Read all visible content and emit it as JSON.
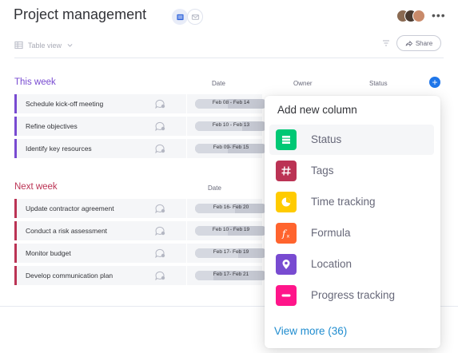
{
  "header": {
    "title": "Project management",
    "table_view_label": "Table view",
    "share_label": "Share",
    "more_label": "•••"
  },
  "columns": {
    "date": "Date",
    "owner": "Owner",
    "status": "Status"
  },
  "groups": [
    {
      "title": "This week",
      "color": "#784bd1",
      "date_header": "Date",
      "rows": [
        {
          "name": "Schedule kick-off meeting",
          "date": "Feb 08 - Feb 14",
          "progress": 0.45
        },
        {
          "name": "Refine objectives",
          "date": "Feb 10 - Feb 13",
          "progress": 0.65
        },
        {
          "name": "Identify key resources",
          "date": "Feb 09- Feb 15",
          "progress": 0.45
        }
      ]
    },
    {
      "title": "Next week",
      "color": "#bb3354",
      "date_header": "Date",
      "rows": [
        {
          "name": "Update contractor agreement",
          "date": "Feb 16- Feb 20",
          "progress": 0.55
        },
        {
          "name": "Conduct a risk assessment",
          "date": "Feb 10 - Feb 19",
          "progress": 0.45
        },
        {
          "name": "Monitor budget",
          "date": "Feb 17- Feb 19",
          "progress": 0.6
        },
        {
          "name": "Develop communication plan",
          "date": "Feb 17- Feb 21",
          "progress": 0.25
        }
      ]
    }
  ],
  "panel": {
    "title": "Add new column",
    "options": [
      {
        "label": "Status",
        "icon": "status-icon",
        "color": "#00c875"
      },
      {
        "label": "Tags",
        "icon": "hash-icon",
        "color": "#bb3354"
      },
      {
        "label": "Time tracking",
        "icon": "clock-icon",
        "color": "#ffcb00"
      },
      {
        "label": "Formula",
        "icon": "function-icon",
        "color": "#ff642e"
      },
      {
        "label": "Location",
        "icon": "location-pin-icon",
        "color": "#784bd1"
      },
      {
        "label": "Progress tracking",
        "icon": "progress-icon",
        "color": "#ff158a"
      }
    ],
    "view_more": "View more (36)"
  },
  "colors": {
    "accent": "#1f76e9",
    "link": "#1f8ccf"
  }
}
